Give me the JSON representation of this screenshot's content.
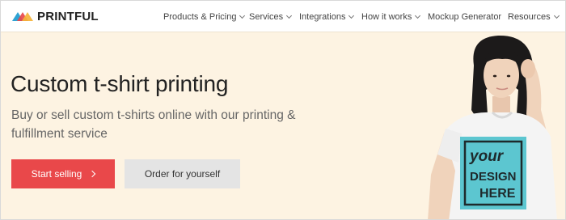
{
  "brand": {
    "name": "PRINTFUL",
    "logo_colors": [
      "#2ea3d4",
      "#e9484a",
      "#f4b33a"
    ]
  },
  "nav": {
    "items": [
      {
        "label": "Products & Pricing",
        "has_dropdown": true
      },
      {
        "label": "Services",
        "has_dropdown": true
      },
      {
        "label": "Integrations",
        "has_dropdown": true
      },
      {
        "label": "How it works",
        "has_dropdown": true
      },
      {
        "label": "Mockup Generator",
        "has_dropdown": false
      },
      {
        "label": "Resources",
        "has_dropdown": true
      }
    ]
  },
  "hero": {
    "title": "Custom t-shirt printing",
    "subtitle": "Buy or sell custom t-shirts online with our printing & fulfillment service",
    "primary_button": "Start selling",
    "secondary_button": "Order for yourself",
    "background_color": "#fdf3e2",
    "primary_color": "#e9484a"
  },
  "model_image": {
    "shirt_print_line1": "your",
    "shirt_print_line2": "DESIGN",
    "shirt_print_line3": "HERE",
    "print_color": "#5cc6d0"
  }
}
